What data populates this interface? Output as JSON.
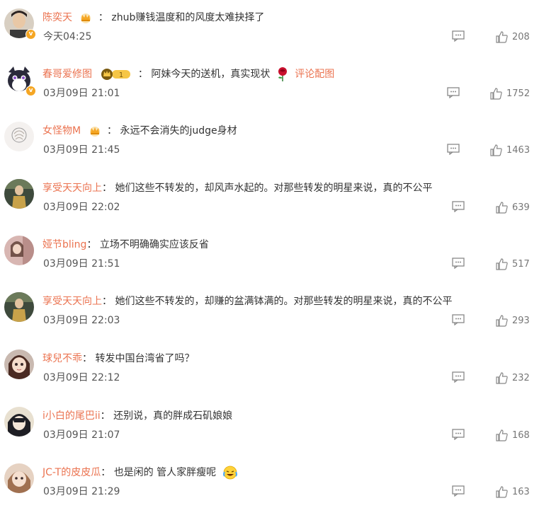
{
  "comments": [
    {
      "username": "陈奕天",
      "text": "zhub赚钱温度和的风度太难抉择了",
      "time": "今天04:25",
      "likes": "208",
      "badge": "crown",
      "avatar": "avatar-1"
    },
    {
      "username": "春哥爱修图",
      "text": "阿妹今天的送机，真实现状",
      "time": "03月09日 21:01",
      "likes": "1752",
      "badge": "level",
      "level": "1",
      "extra_link": "评论配图",
      "avatar": "avatar-2"
    },
    {
      "username": "女怪物M",
      "text": "永远不会消失的judge身材",
      "time": "03月09日 21:45",
      "likes": "1463",
      "badge": "crown",
      "avatar": "avatar-3"
    },
    {
      "username": "享受天天向上",
      "text": "她们这些不转发的，却风声水起的。对那些转发的明星来说，真的不公平",
      "time": "03月09日 22:02",
      "likes": "639",
      "avatar": "avatar-4"
    },
    {
      "username": "娅节bling",
      "text": "立场不明确确实应该反省",
      "time": "03月09日 21:51",
      "likes": "517",
      "avatar": "avatar-5"
    },
    {
      "username": "享受天天向上",
      "text": "她们这些不转发的，却赚的盆满钵满的。对那些转发的明星来说，真的不公平",
      "time": "03月09日 22:03",
      "likes": "293",
      "avatar": "avatar-6"
    },
    {
      "username": "球兒不乖",
      "text": "转发中国台湾省了吗？",
      "time": "03月09日 22:12",
      "likes": "232",
      "avatar": "avatar-7"
    },
    {
      "username": "i小白的尾巴ii",
      "text": "还别说，真的胖成石矶娘娘",
      "time": "03月09日 21:07",
      "likes": "168",
      "avatar": "avatar-8"
    },
    {
      "username": "JC-T的皮皮瓜",
      "text": "也是闲的 管人家胖瘦呢",
      "time": "03月09日 21:29",
      "likes": "163",
      "avatar": "avatar-9"
    }
  ],
  "colon": "：",
  "colors": {
    "username": "#eb7350",
    "text": "#333333",
    "meta": "#777777",
    "badge": "#f5a623"
  }
}
